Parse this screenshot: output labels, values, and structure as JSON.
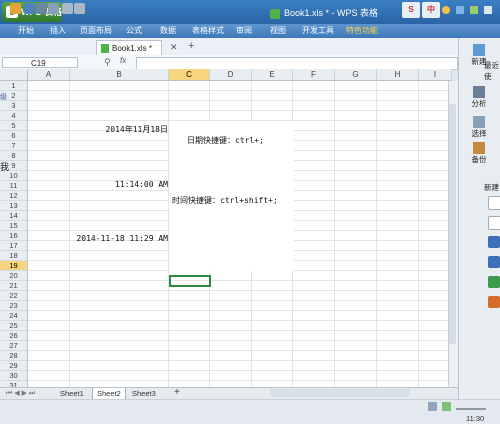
{
  "app": {
    "name": "WPS 表格",
    "logo": "5",
    "window_title": "Book1.xls * - WPS 表格"
  },
  "title_buttons": [
    "S",
    "中"
  ],
  "menu": [
    "开始",
    "插入",
    "页面布局",
    "公式",
    "数据",
    "表格样式",
    "审阅",
    "视图",
    "开发工具",
    "特色功能"
  ],
  "doc_tab": {
    "label": "Book1.xls *"
  },
  "namebox": {
    "value": "C19"
  },
  "formula": {
    "fx": "fx",
    "value": ""
  },
  "columns": [
    "A",
    "B",
    "C",
    "D",
    "E",
    "F",
    "G",
    "H",
    "I"
  ],
  "rows": [
    "1",
    "2",
    "3",
    "4",
    "5",
    "6",
    "7",
    "8",
    "9",
    "10",
    "11",
    "12",
    "13",
    "14",
    "15",
    "16",
    "17",
    "18",
    "19",
    "20",
    "21",
    "22",
    "23",
    "24",
    "25",
    "26",
    "27",
    "28",
    "29",
    "30",
    "31"
  ],
  "selected": {
    "cell": "C19",
    "column": "C",
    "row": "19"
  },
  "cells": {
    "b5": "2014年11月18日",
    "c6": "日期快捷键：ctrl+;",
    "b10": "11:14:00 AM",
    "c11": "时间快捷键：ctrl+shift+;",
    "b15": "2014-11-18 11:29 AM"
  },
  "sheets": [
    "Sheet1",
    "Sheet2",
    "Sheet3"
  ],
  "active_sheet": "Sheet2",
  "add_sheet": "+",
  "right_panel": {
    "top": "最近使",
    "items": [
      "新建",
      "分析",
      "选择",
      "备份"
    ],
    "new_label": "新建"
  },
  "left_edge": [
    "级",
    "我"
  ],
  "status": {
    "time": "11:30"
  },
  "colors": {
    "title": "#2a64a4",
    "menu": "#3e78b8",
    "selection": "#2e8b3e",
    "header_sel": "#f7d57e"
  }
}
